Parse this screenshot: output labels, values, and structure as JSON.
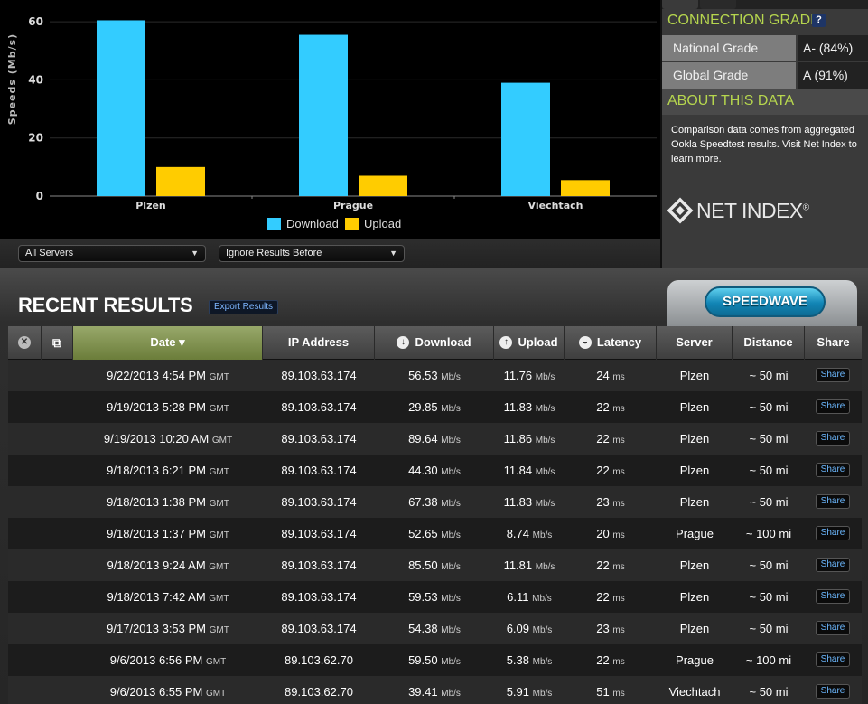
{
  "chart_data": {
    "type": "bar",
    "categories": [
      "Plzen",
      "Prague",
      "Viechtach"
    ],
    "series": [
      {
        "name": "Download",
        "values": [
          60.5,
          55.5,
          39
        ],
        "color": "#33ccff"
      },
      {
        "name": "Upload",
        "values": [
          10,
          7,
          5.5
        ],
        "color": "#ffcc00"
      }
    ],
    "ylabel": "Speeds (Mb/s)",
    "yticks": [
      0,
      20,
      40,
      60
    ],
    "ylim": [
      0,
      65
    ],
    "grid": true,
    "legend_position": "bottom-center"
  },
  "filters": {
    "servers": "All Servers",
    "ignore_before": "Ignore Results Before"
  },
  "grade": {
    "title": "CONNECTION GRADE",
    "help": "?",
    "national_label": "National Grade",
    "national_value": "A- (84%)",
    "global_label": "Global Grade",
    "global_value": "A (91%)"
  },
  "about": {
    "title": "ABOUT THIS DATA",
    "body": "Comparison data comes from aggregated Ookla Speedtest results. Visit Net Index to learn more."
  },
  "logo": {
    "text": "NET INDEX",
    "mark": "®"
  },
  "results": {
    "title": "RECENT RESULTS",
    "export_label": "Export Results",
    "speedwave_label": "SPEEDWAVE"
  },
  "table": {
    "headers": {
      "date": "Date ▾",
      "ip": "IP Address",
      "download": "Download",
      "upload": "Upload",
      "latency": "Latency",
      "server": "Server",
      "distance": "Distance",
      "share": "Share"
    },
    "rows": [
      {
        "date": "9/22/2013 4:54 PM",
        "tz": "GMT",
        "ip": "89.103.63.174",
        "download": "56.53",
        "upload": "11.76",
        "latency": "24",
        "server": "Plzen",
        "distance": "~ 50 mi"
      },
      {
        "date": "9/19/2013 5:28 PM",
        "tz": "GMT",
        "ip": "89.103.63.174",
        "download": "29.85",
        "upload": "11.83",
        "latency": "22",
        "server": "Plzen",
        "distance": "~ 50 mi"
      },
      {
        "date": "9/19/2013 10:20 AM",
        "tz": "GMT",
        "ip": "89.103.63.174",
        "download": "89.64",
        "upload": "11.86",
        "latency": "22",
        "server": "Plzen",
        "distance": "~ 50 mi"
      },
      {
        "date": "9/18/2013 6:21 PM",
        "tz": "GMT",
        "ip": "89.103.63.174",
        "download": "44.30",
        "upload": "11.84",
        "latency": "22",
        "server": "Plzen",
        "distance": "~ 50 mi"
      },
      {
        "date": "9/18/2013 1:38 PM",
        "tz": "GMT",
        "ip": "89.103.63.174",
        "download": "67.38",
        "upload": "11.83",
        "latency": "23",
        "server": "Plzen",
        "distance": "~ 50 mi"
      },
      {
        "date": "9/18/2013 1:37 PM",
        "tz": "GMT",
        "ip": "89.103.63.174",
        "download": "52.65",
        "upload": "8.74",
        "latency": "20",
        "server": "Prague",
        "distance": "~ 100 mi"
      },
      {
        "date": "9/18/2013 9:24 AM",
        "tz": "GMT",
        "ip": "89.103.63.174",
        "download": "85.50",
        "upload": "11.81",
        "latency": "22",
        "server": "Plzen",
        "distance": "~ 50 mi"
      },
      {
        "date": "9/18/2013 7:42 AM",
        "tz": "GMT",
        "ip": "89.103.63.174",
        "download": "59.53",
        "upload": "6.11",
        "latency": "22",
        "server": "Plzen",
        "distance": "~ 50 mi"
      },
      {
        "date": "9/17/2013 3:53 PM",
        "tz": "GMT",
        "ip": "89.103.63.174",
        "download": "54.38",
        "upload": "6.09",
        "latency": "23",
        "server": "Plzen",
        "distance": "~ 50 mi"
      },
      {
        "date": "9/6/2013 6:56 PM",
        "tz": "GMT",
        "ip": "89.103.62.70",
        "download": "59.50",
        "upload": "5.38",
        "latency": "22",
        "server": "Prague",
        "distance": "~ 100 mi"
      },
      {
        "date": "9/6/2013 6:55 PM",
        "tz": "GMT",
        "ip": "89.103.62.70",
        "download": "39.41",
        "upload": "5.91",
        "latency": "51",
        "server": "Viechtach",
        "distance": "~ 50 mi"
      }
    ],
    "speed_unit": "Mb/s",
    "latency_unit": "ms",
    "share_label": "Share"
  }
}
